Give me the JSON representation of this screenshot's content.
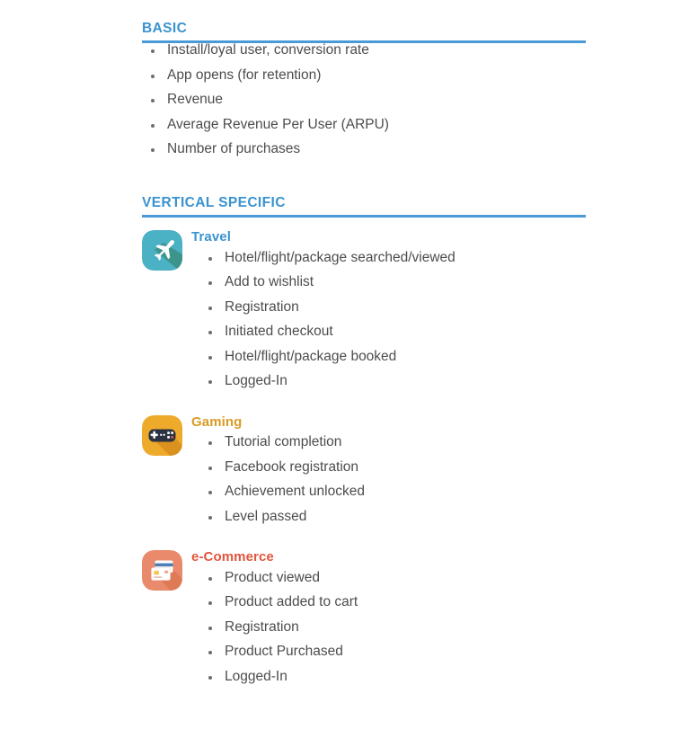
{
  "theme": {
    "header_color": "#3a93d0",
    "rule_color": "#4a9ad8",
    "body_text_color": "#4d4d4d",
    "bullet_color": "#6d6d6d",
    "travel_color": "#3a93d0",
    "gaming_color": "#d99b26",
    "ecommerce_color": "#e2553c",
    "page_background": "#ffffff"
  },
  "sections": {
    "basic": {
      "title": "BASIC",
      "items": [
        "Install/loyal user, conversion rate",
        "App opens (for retention)",
        "Revenue",
        "Average Revenue Per User (ARPU)",
        "Number of purchases"
      ]
    },
    "vertical_specific": {
      "title": "VERTICAL SPECIFIC",
      "verticals": [
        {
          "name": "Travel",
          "icon": "airplane-icon",
          "icon_bg": "#4bb1c4",
          "items": [
            "Hotel/flight/package searched/viewed",
            "Add to wishlist",
            "Registration",
            "Initiated checkout",
            "Hotel/flight/package booked",
            "Logged-In"
          ]
        },
        {
          "name": "Gaming",
          "icon": "gamepad-icon",
          "icon_bg": "#eeaa2b",
          "items": [
            "Tutorial completion",
            "Facebook registration",
            "Achievement unlocked",
            "Level passed"
          ]
        },
        {
          "name": "e-Commerce",
          "icon": "credit-cards-icon",
          "icon_bg": "#e98a6d",
          "items": [
            "Product viewed",
            "Product added to cart",
            "Registration",
            "Product Purchased",
            "Logged-In"
          ]
        }
      ]
    }
  }
}
